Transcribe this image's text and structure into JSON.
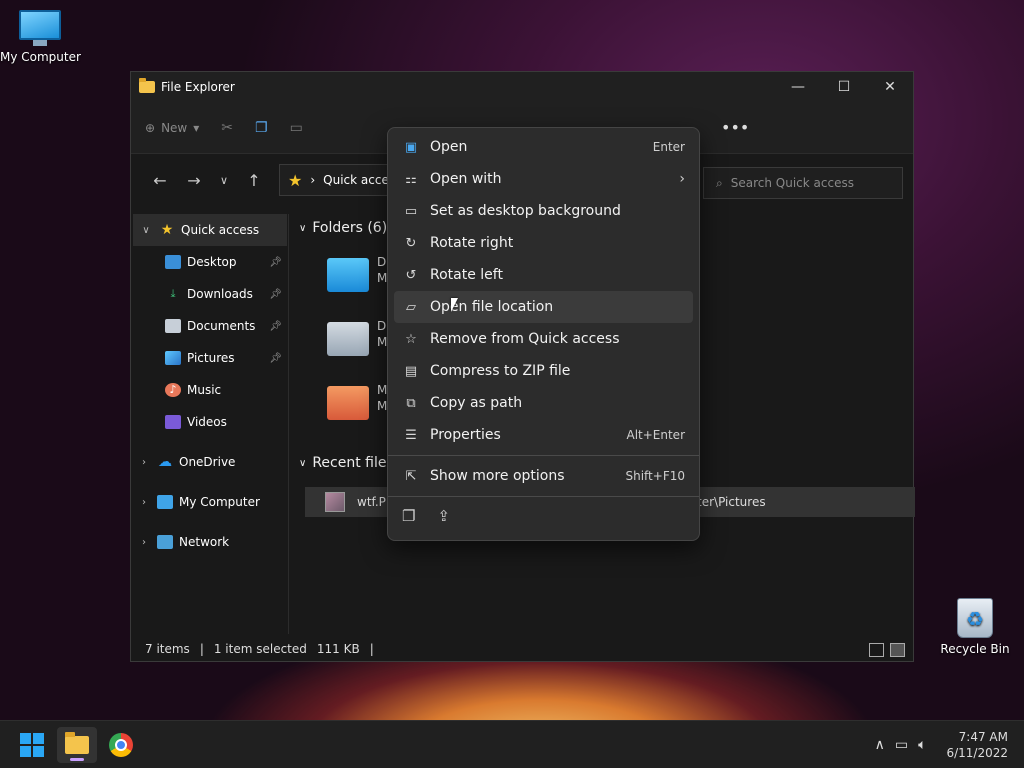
{
  "desktop": {
    "icons": [
      {
        "label": "My Computer"
      },
      {
        "label": "Recycle Bin"
      }
    ]
  },
  "window": {
    "title": "File Explorer",
    "toolbar": {
      "new_label": "New"
    },
    "address": {
      "path": "Quick access"
    },
    "search": {
      "placeholder": "Search Quick access"
    }
  },
  "sidebar": {
    "quick_access": "Quick access",
    "pinned": [
      {
        "label": "Desktop"
      },
      {
        "label": "Downloads"
      },
      {
        "label": "Documents"
      },
      {
        "label": "Pictures"
      },
      {
        "label": "Music"
      },
      {
        "label": "Videos"
      }
    ],
    "onedrive": "OneDrive",
    "my_computer": "My Computer",
    "network": "Network"
  },
  "content": {
    "folders_header": "Folders (6)",
    "folder_tiles": [
      {
        "name": "D",
        "sub": "M"
      },
      {
        "name": "D",
        "sub": "M"
      },
      {
        "name": "M",
        "sub": "M"
      }
    ],
    "recent_header": "Recent files",
    "recent_file": {
      "name": "wtf.Pl",
      "location": "ter\\Pictures"
    }
  },
  "status": {
    "items": "7 items",
    "selected": "1 item selected",
    "size": "111 KB"
  },
  "context_menu": {
    "items": [
      {
        "label": "Open",
        "shortcut": "Enter"
      },
      {
        "label": "Open with",
        "shortcut": ""
      },
      {
        "label": "Set as desktop background",
        "shortcut": ""
      },
      {
        "label": "Rotate right",
        "shortcut": ""
      },
      {
        "label": "Rotate left",
        "shortcut": ""
      },
      {
        "label": "Open file location",
        "shortcut": ""
      },
      {
        "label": "Remove from Quick access",
        "shortcut": ""
      },
      {
        "label": "Compress to ZIP file",
        "shortcut": ""
      },
      {
        "label": "Copy as path",
        "shortcut": ""
      },
      {
        "label": "Properties",
        "shortcut": "Alt+Enter"
      }
    ],
    "more": {
      "label": "Show more options",
      "shortcut": "Shift+F10"
    }
  },
  "taskbar": {
    "time": "7:47 AM",
    "date": "6/11/2022"
  },
  "colors": {
    "accent": "#2aa7f5",
    "folder": "#f4c44c",
    "menu_bg": "#2c2c2c"
  }
}
